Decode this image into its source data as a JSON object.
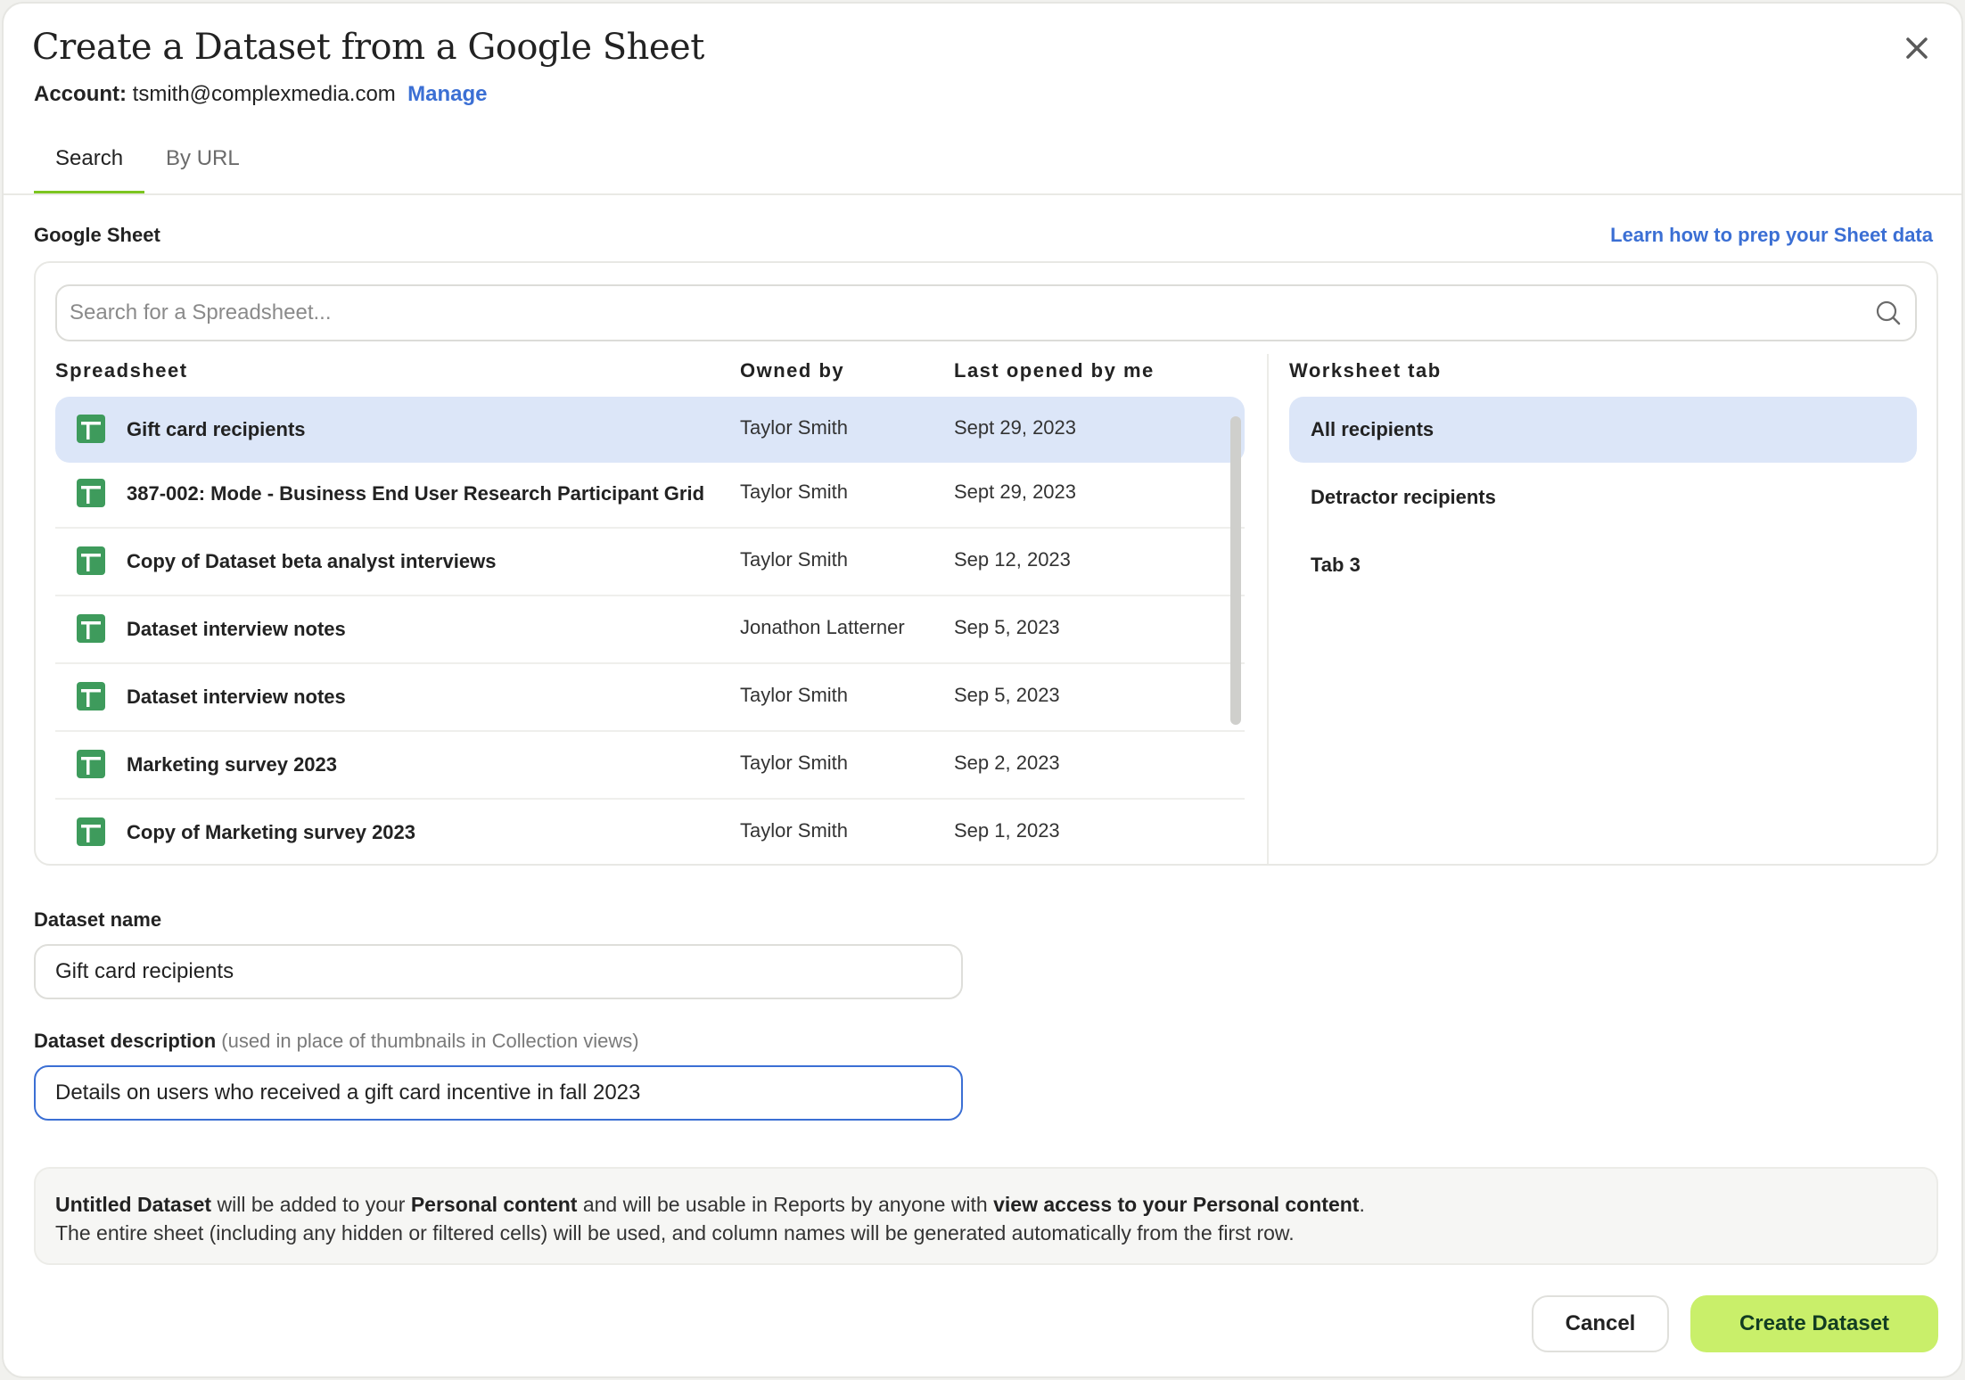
{
  "dialog": {
    "title": "Create a Dataset from a Google Sheet",
    "account_label": "Account:",
    "account_email": "tsmith@complexmedia.com",
    "manage_link": "Manage",
    "close_icon": "close-icon"
  },
  "tabs": [
    {
      "label": "Search",
      "active": true
    },
    {
      "label": "By URL",
      "active": false
    }
  ],
  "google_sheet": {
    "label": "Google Sheet",
    "help_link": "Learn how to prep your Sheet data",
    "search_placeholder": "Search for a Spreadsheet...",
    "search_value": "",
    "search_icon": "search-icon",
    "columns": {
      "spreadsheet": "Spreadsheet",
      "owned_by": "Owned by",
      "last_opened": "Last opened by me",
      "worksheet_tab": "Worksheet tab"
    },
    "rows": [
      {
        "name": "Gift card recipients",
        "owner": "Taylor Smith",
        "date": "Sept 29, 2023",
        "selected": true
      },
      {
        "name": "387-002: Mode - Business End User Research Participant Grid",
        "owner": "Taylor Smith",
        "date": "Sept 29, 2023",
        "selected": false
      },
      {
        "name": "Copy of Dataset beta analyst interviews",
        "owner": "Taylor Smith",
        "date": "Sep 12, 2023",
        "selected": false
      },
      {
        "name": "Dataset interview notes",
        "owner": "Jonathon Latterner",
        "date": "Sep 5, 2023",
        "selected": false
      },
      {
        "name": "Dataset interview notes",
        "owner": "Taylor Smith",
        "date": "Sep 5, 2023",
        "selected": false
      },
      {
        "name": "Marketing survey 2023",
        "owner": "Taylor Smith",
        "date": "Sep 2, 2023",
        "selected": false
      },
      {
        "name": "Copy of Marketing survey 2023",
        "owner": "Taylor Smith",
        "date": "Sep 1, 2023",
        "selected": false
      }
    ],
    "worksheet_tabs": [
      {
        "label": "All recipients",
        "selected": true
      },
      {
        "label": "Detractor recipients",
        "selected": false
      },
      {
        "label": "Tab 3",
        "selected": false
      }
    ]
  },
  "form": {
    "name_label": "Dataset name",
    "name_value": "Gift card recipients",
    "description_label": "Dataset description",
    "description_hint": "(used in place of thumbnails in Collection views)",
    "description_value": "Details on users who received a gift card incentive in fall 2023"
  },
  "info": {
    "line1": [
      {
        "text": "Untitled Dataset",
        "bold": true
      },
      {
        "text": " will be added to your ",
        "bold": false
      },
      {
        "text": "Personal content",
        "bold": true
      },
      {
        "text": " and will be usable in Reports by anyone with ",
        "bold": false
      },
      {
        "text": "view access to your Personal content",
        "bold": true
      },
      {
        "text": ".",
        "bold": false
      }
    ],
    "line2": "The entire sheet (including any hidden or filtered cells) will be used, and column names will be generated automatically from the first row."
  },
  "buttons": {
    "cancel": "Cancel",
    "create": "Create Dataset"
  },
  "colors": {
    "accent_green": "#7cc520",
    "primary_button": "#c9ef6a",
    "link_blue": "#3b6fd4",
    "selection_blue": "#dce6f8",
    "sheet_icon_green": "#3e9b5c"
  }
}
